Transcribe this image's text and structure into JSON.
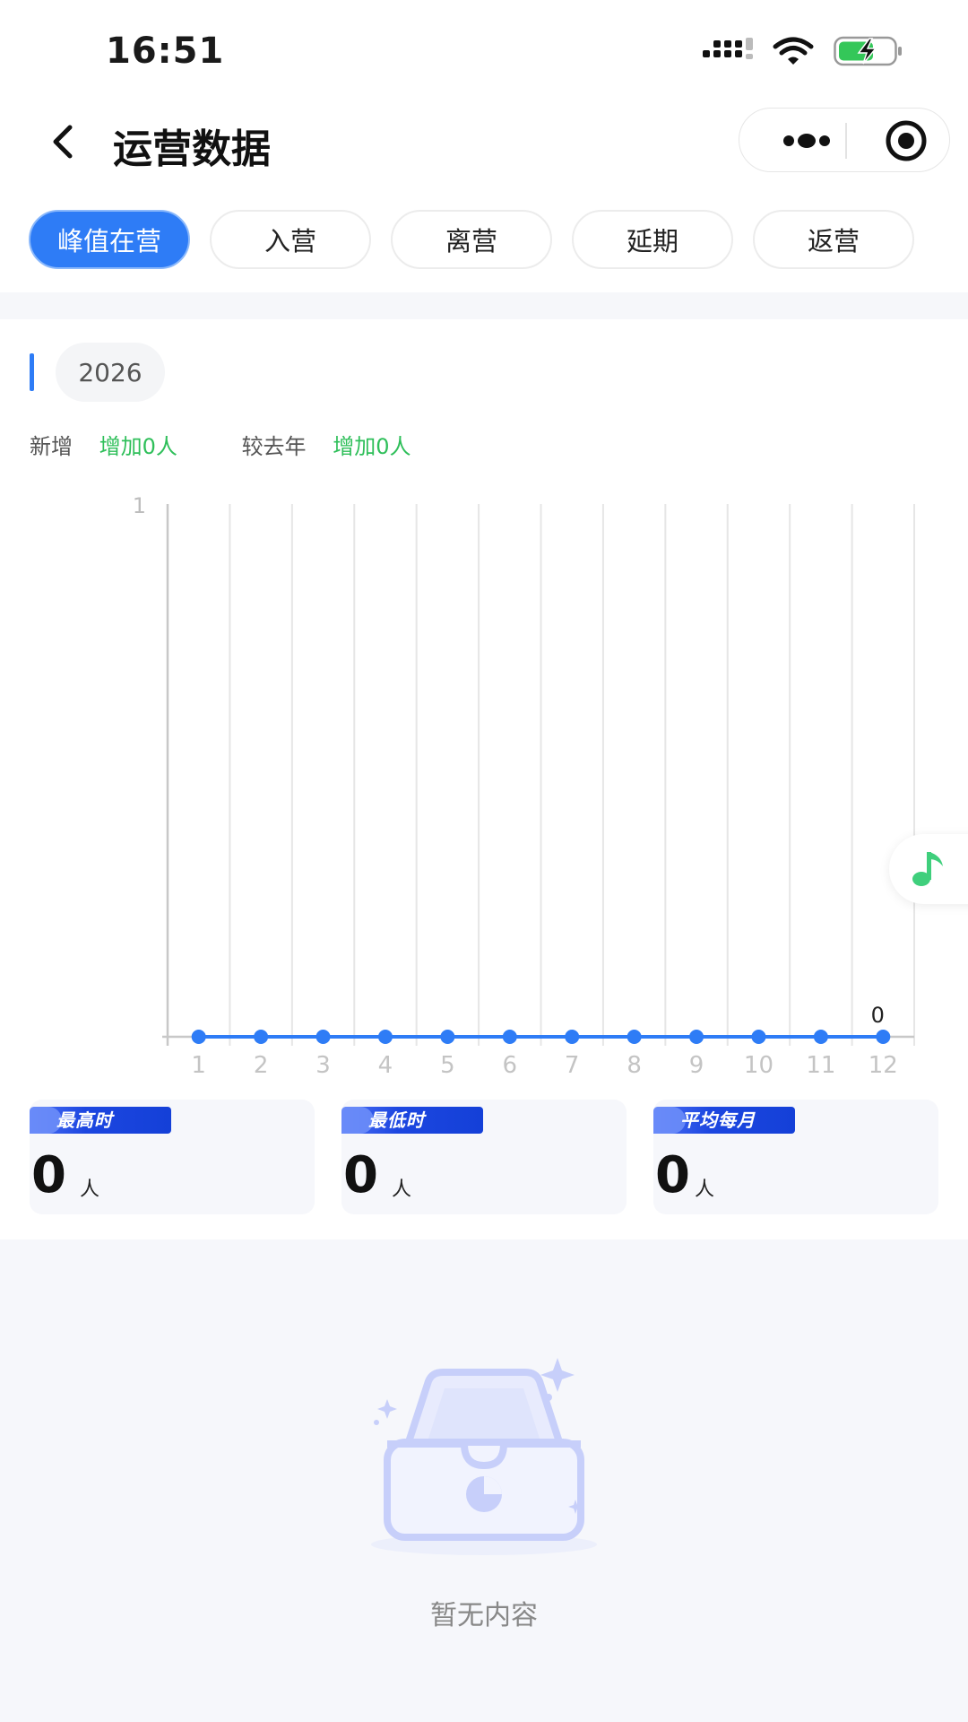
{
  "status_bar": {
    "time": "16:51"
  },
  "nav": {
    "title": "运营数据"
  },
  "tabs": [
    {
      "label": "峰值在营",
      "active": true
    },
    {
      "label": "入营",
      "active": false
    },
    {
      "label": "离营",
      "active": false
    },
    {
      "label": "延期",
      "active": false
    },
    {
      "label": "返营",
      "active": false
    }
  ],
  "year": "2026",
  "stats": {
    "new_label": "新增",
    "new_value": "增加0人",
    "yoy_label": "较去年",
    "yoy_value": "增加0人"
  },
  "chart_data": {
    "type": "line",
    "categories": [
      "1",
      "2",
      "3",
      "4",
      "5",
      "6",
      "7",
      "8",
      "9",
      "10",
      "11",
      "12"
    ],
    "values": [
      0,
      0,
      0,
      0,
      0,
      0,
      0,
      0,
      0,
      0,
      0,
      0
    ],
    "ylim": [
      0,
      1
    ],
    "y_ticks": [
      "1"
    ],
    "data_labels": {
      "last": "0"
    },
    "grid": true,
    "color": "#2e7cf6"
  },
  "cards": [
    {
      "tag": "最高时",
      "value": "0",
      "unit": "人"
    },
    {
      "tag": "最低时",
      "value": "0",
      "unit": "人"
    },
    {
      "tag": "平均每月",
      "value": "0",
      "unit": "人"
    }
  ],
  "empty": {
    "text": "暂无内容"
  },
  "colors": {
    "accent": "#2e7cf6",
    "positive": "#2fbf5a",
    "float_icon": "#3fcf7c"
  },
  "icons": {
    "back": "chevron-left-icon",
    "more": "more-dots-icon",
    "close": "target-circle-icon",
    "music": "music-note-icon",
    "empty": "empty-inbox-icon"
  }
}
